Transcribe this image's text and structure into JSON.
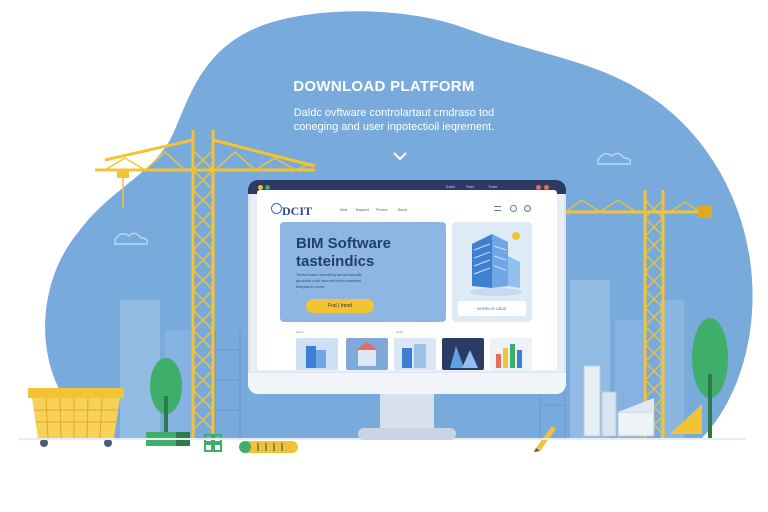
{
  "hero": {
    "title": "DOWNLOAD PLATFORM",
    "subtitle_line1": "Daldc ovftware controlartaut cmdraso tod",
    "subtitle_line2": "coneging and user inpotectioil ieqrement."
  },
  "monitor": {
    "topbar_labels": [
      "Eaml",
      "Ssel",
      "Tmer"
    ],
    "site": {
      "logo": "DCIT",
      "nav": [
        "Bbd",
        "Bapefd",
        "Fbrme",
        "Bevd"
      ]
    },
    "hero_card": {
      "title_line1": "BIM Software",
      "title_line2": "tasteindics",
      "body_line1": "Tecitul taeed sermiting tomel ebeoitto",
      "body_line2": "geovaltd cuat lmoned ineivot aoeteel",
      "body_line3": "bsegueod cevel.",
      "cta": "Fnd | Imnd"
    },
    "feature_card": {
      "badge": "BORELIS CBDE"
    },
    "thumbnails": {
      "labels": [
        "Goed",
        "Aeed"
      ]
    }
  },
  "colors": {
    "sky_blob": "#78aadb",
    "crane_yellow": "#f2c335",
    "building_blue": "#9cc2e8",
    "tree_green": "#3fae6a",
    "accent_navy": "#1f3f73",
    "cta_yellow": "#f2c335"
  },
  "icons": [
    "chevron-down-icon",
    "tower-crane-icon",
    "basket-icon",
    "tree-icon",
    "ruler-icon",
    "pencil-icon",
    "building-icon"
  ]
}
